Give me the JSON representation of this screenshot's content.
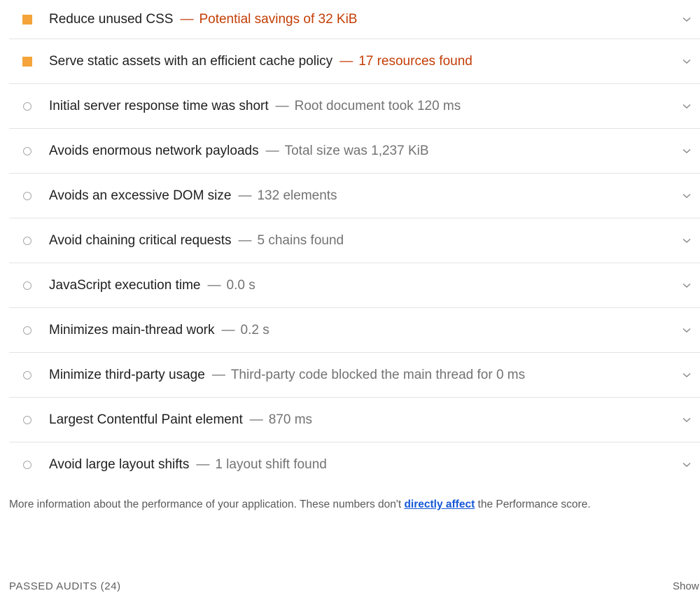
{
  "audits": [
    {
      "title": "Reduce unused CSS",
      "sep": "—",
      "detail": "Potential savings of 32 KiB",
      "status": "warn",
      "icon": "orange-square-icon"
    },
    {
      "title": "Serve static assets with an efficient cache policy",
      "sep": "—",
      "detail": "17 resources found",
      "status": "warn",
      "icon": "orange-square-icon"
    },
    {
      "title": "Initial server response time was short",
      "sep": "—",
      "detail": "Root document took 120 ms",
      "status": "info",
      "icon": "gray-circle-icon"
    },
    {
      "title": "Avoids enormous network payloads",
      "sep": "—",
      "detail": "Total size was 1,237 KiB",
      "status": "info",
      "icon": "gray-circle-icon"
    },
    {
      "title": "Avoids an excessive DOM size",
      "sep": "—",
      "detail": "132 elements",
      "status": "info",
      "icon": "gray-circle-icon"
    },
    {
      "title": "Avoid chaining critical requests",
      "sep": "—",
      "detail": "5 chains found",
      "status": "info",
      "icon": "gray-circle-icon"
    },
    {
      "title": "JavaScript execution time",
      "sep": "—",
      "detail": "0.0 s",
      "status": "info",
      "icon": "gray-circle-icon"
    },
    {
      "title": "Minimizes main-thread work",
      "sep": "—",
      "detail": "0.2 s",
      "status": "info",
      "icon": "gray-circle-icon"
    },
    {
      "title": "Minimize third-party usage",
      "sep": "—",
      "detail": "Third-party code blocked the main thread for 0 ms",
      "status": "info",
      "icon": "gray-circle-icon"
    },
    {
      "title": "Largest Contentful Paint element",
      "sep": "—",
      "detail": "870 ms",
      "status": "info",
      "icon": "gray-circle-icon"
    },
    {
      "title": "Avoid large layout shifts",
      "sep": "—",
      "detail": "1 layout shift found",
      "status": "info",
      "icon": "gray-circle-icon"
    }
  ],
  "footnote": {
    "before": "More information about the performance of your application. These numbers don't ",
    "link": "directly affect",
    "after": " the Performance score."
  },
  "passed": {
    "label": "PASSED AUDITS (24)",
    "show": "Show"
  },
  "colors": {
    "warn_icon": "#f4a43a",
    "warn_text": "#c33e06",
    "info_text": "#737373",
    "link": "#1558d6"
  }
}
